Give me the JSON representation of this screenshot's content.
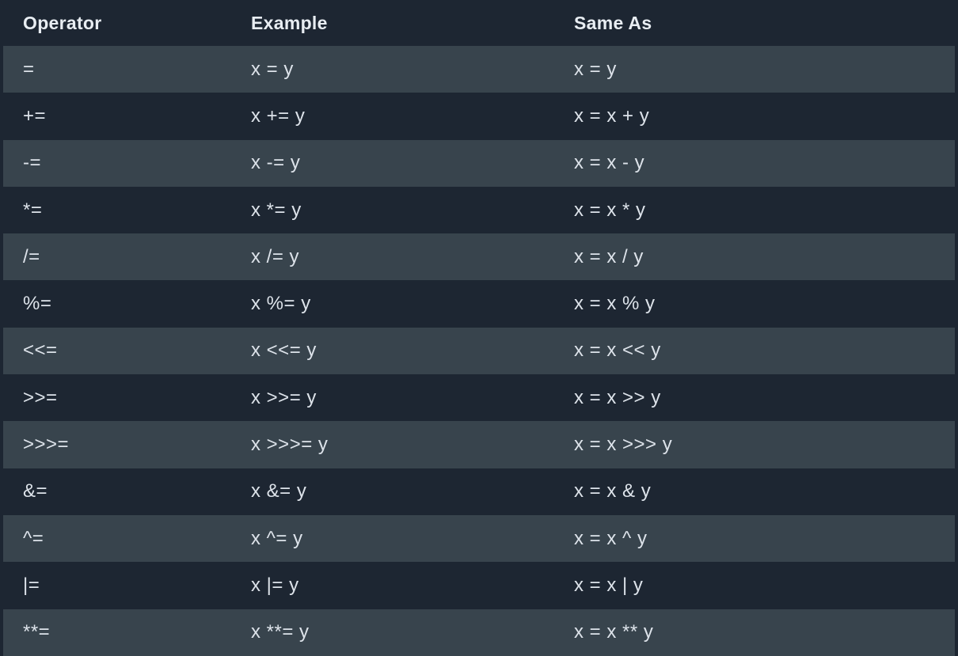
{
  "table": {
    "headers": [
      "Operator",
      "Example",
      "Same As"
    ],
    "rows": [
      [
        "=",
        "x = y",
        "x = y"
      ],
      [
        "+=",
        "x += y",
        "x = x + y"
      ],
      [
        "-=",
        "x -= y",
        "x = x - y"
      ],
      [
        "*=",
        "x *= y",
        "x = x * y"
      ],
      [
        "/=",
        "x /= y",
        "x = x / y"
      ],
      [
        "%=",
        "x %= y",
        "x = x % y"
      ],
      [
        "<<=",
        "x <<= y",
        "x = x << y"
      ],
      [
        ">>=",
        "x >>= y",
        "x = x >> y"
      ],
      [
        ">>>=",
        "x >>>= y",
        "x = x >>> y"
      ],
      [
        "&=",
        "x &= y",
        "x = x & y"
      ],
      [
        "^=",
        "x ^= y",
        "x = x ^ y"
      ],
      [
        "|=",
        "x |= y",
        "x = x | y"
      ],
      [
        "**=",
        "x **= y",
        "x = x ** y"
      ]
    ]
  }
}
